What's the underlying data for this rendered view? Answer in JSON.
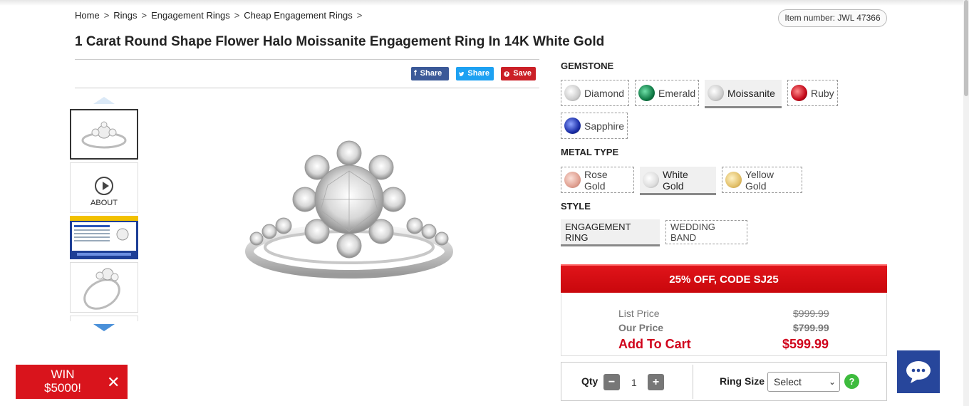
{
  "breadcrumb": [
    "Home",
    "Rings",
    "Engagement Rings",
    "Cheap Engagement Rings"
  ],
  "breadcrumb_sep": ">",
  "item_number": "Item number: JWL 47366",
  "title": "1 Carat Round Shape Flower Halo Moissanite Engagement Ring In 14K White Gold",
  "share": {
    "facebook": "Share",
    "twitter": "Share",
    "pinterest": "Save"
  },
  "thumbnails": {
    "about": "ABOUT"
  },
  "gemstone": {
    "label": "GEMSTONE",
    "options": [
      "Diamond",
      "Emerald",
      "Moissanite",
      "Ruby",
      "Sapphire"
    ],
    "selected": "Moissanite"
  },
  "metal": {
    "label": "METAL TYPE",
    "options": [
      "Rose Gold",
      "White Gold",
      "Yellow Gold"
    ],
    "selected": "White Gold"
  },
  "style": {
    "label": "STYLE",
    "options": [
      "ENGAGEMENT RING",
      "WEDDING BAND"
    ],
    "selected": "ENGAGEMENT RING"
  },
  "promo": "25% OFF, CODE SJ25",
  "price": {
    "list_label": "List Price",
    "list_value": "$999.99",
    "our_label": "Our Price",
    "our_value": "$799.99",
    "cart_label": "Add To Cart",
    "cart_value": "$599.99"
  },
  "qty": {
    "label": "Qty",
    "value": "1",
    "minus": "−",
    "plus": "+"
  },
  "ring_size": {
    "label": "Ring Size",
    "selected": "Select",
    "help": "?"
  },
  "win_banner": {
    "line1": "WIN",
    "line2": "$5000!",
    "close": "✕"
  },
  "colors": {
    "promo_red": "#d9141c",
    "price_red": "#d0021b",
    "chat_blue": "#27469b"
  }
}
